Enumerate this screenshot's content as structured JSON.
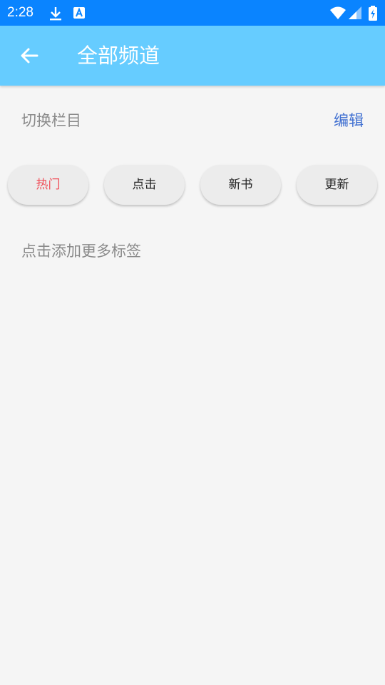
{
  "status_bar": {
    "time": "2:28",
    "icons": [
      "download-icon",
      "a-notification-icon",
      "wifi-icon",
      "signal-icon",
      "battery-icon"
    ]
  },
  "app_bar": {
    "back_icon": "arrow-left-icon",
    "title": "全部频道",
    "background": "#66ccff"
  },
  "channels": {
    "section_title": "切换栏目",
    "edit_label": "编辑",
    "items": [
      {
        "label": "热门",
        "active": true
      },
      {
        "label": "点击",
        "active": false
      },
      {
        "label": "新书",
        "active": false
      },
      {
        "label": "更新",
        "active": false
      }
    ],
    "add_hint": "点击添加更多标签"
  },
  "colors": {
    "status_bar": "#0a84ff",
    "accent": "#3f6fd1",
    "active_chip_text": "#f0505a",
    "page_bg": "#f5f5f5"
  }
}
